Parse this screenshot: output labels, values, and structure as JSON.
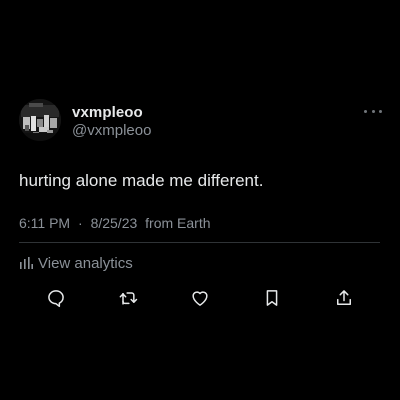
{
  "tweet": {
    "author": {
      "display_name": "vxmpleoo",
      "handle": "@vxmpleoo",
      "avatar": "avatar-image"
    },
    "text": "hurting alone made me different.",
    "meta": {
      "time": "6:11 PM",
      "separator": "·",
      "date": "8/25/23",
      "source": "from Earth"
    },
    "analytics_label": "View analytics",
    "actions": [
      {
        "name": "reply",
        "icon": "reply-icon"
      },
      {
        "name": "retweet",
        "icon": "retweet-icon"
      },
      {
        "name": "like",
        "icon": "heart-icon"
      },
      {
        "name": "bookmark",
        "icon": "bookmark-icon"
      },
      {
        "name": "share",
        "icon": "share-icon"
      }
    ],
    "more_icon": "more-icon"
  },
  "colors": {
    "background": "#000000",
    "primary_text": "#e7e9ea",
    "secondary_text": "#8b9198",
    "divider": "#2f3336"
  }
}
